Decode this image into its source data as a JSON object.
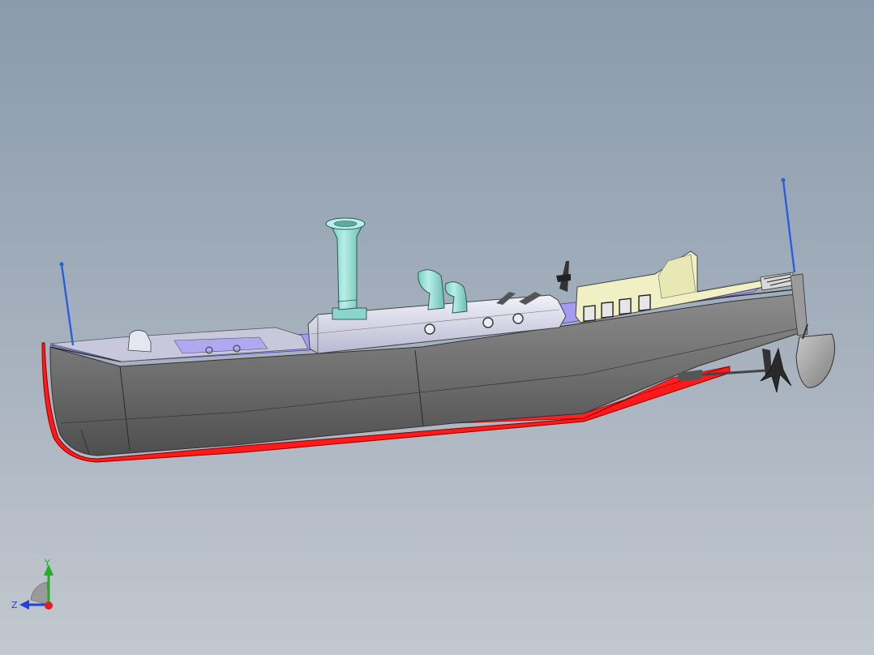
{
  "viewport": {
    "background_top": "#8a9bad",
    "background_bottom": "#c2c8cf"
  },
  "model": {
    "hull_color": "#6a6a6a",
    "keel_color": "#ff1a1a",
    "deck_color": "#a59cf2",
    "superstructure_color": "#dcdcf0",
    "funnel_color": "#9fe0d6",
    "wheelhouse_color": "#f0f0c4",
    "mast_color": "#2a5de0"
  },
  "triad": {
    "y_label": "Y",
    "z_label": "Z",
    "x_color": "#e02020",
    "y_color": "#20b020",
    "z_color": "#2040e0"
  }
}
